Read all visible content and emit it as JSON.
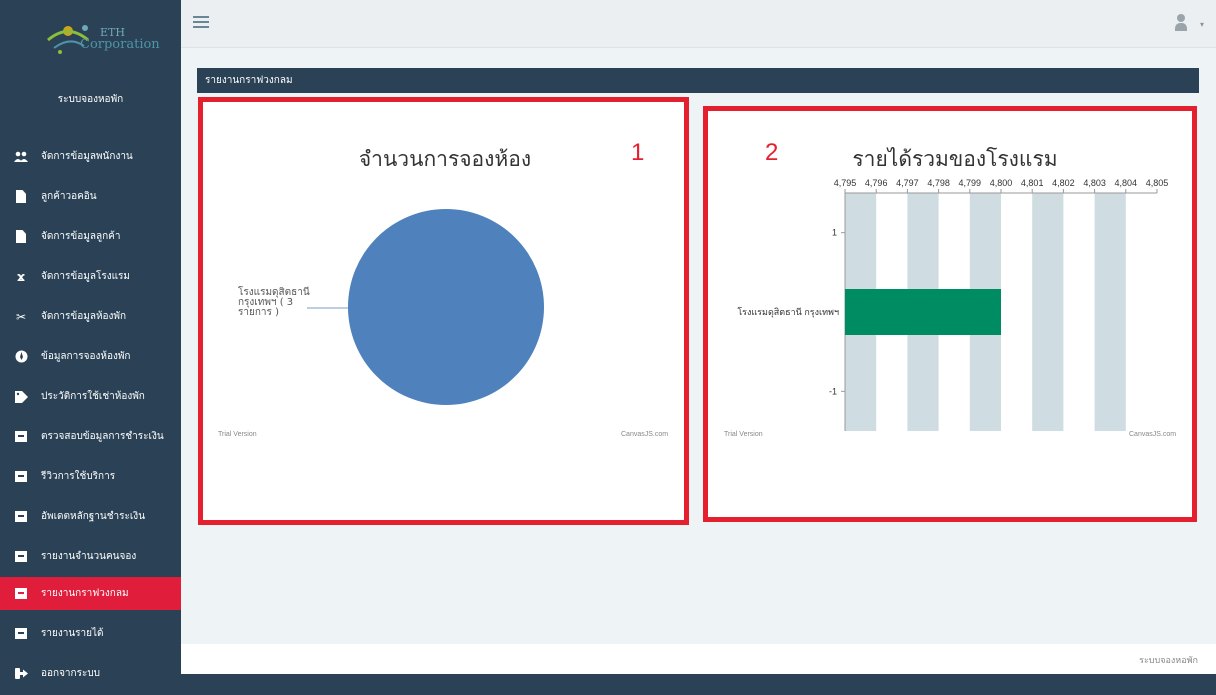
{
  "app": {
    "logo": {
      "small": "ETH",
      "big": "Corporation"
    },
    "title": "ระบบจองหอพัก"
  },
  "sidebar": {
    "items": [
      {
        "label": "จัดการข้อมูลพนักงาน",
        "icon": "users-icon"
      },
      {
        "label": "ลูกค้าวอคอิน",
        "icon": "file-icon"
      },
      {
        "label": "จัดการข้อมูลลูกค้า",
        "icon": "file-icon"
      },
      {
        "label": "จัดการข้อมูลโรงแรม",
        "icon": "xing-icon"
      },
      {
        "label": "จัดการข้อมูลห้องพัก",
        "icon": "scissors-icon"
      },
      {
        "label": "ข้อมูลการจองห้องพัก",
        "icon": "rebel-icon"
      },
      {
        "label": "ประวัติการใช้เช่าห้องพัก",
        "icon": "tag-icon"
      },
      {
        "label": "ตรวจสอบข้อมูลการชำระเงิน",
        "icon": "archive-icon"
      },
      {
        "label": "รีวิวการใช้บริการ",
        "icon": "archive-icon"
      },
      {
        "label": "อัพเดตหลักฐานชำระเงิน",
        "icon": "archive-icon"
      },
      {
        "label": "รายงานจำนวนคนจอง",
        "icon": "archive-icon"
      },
      {
        "label": "รายงานกราฟวงกลม",
        "icon": "archive-icon",
        "active": true
      },
      {
        "label": "รายงานรายได้",
        "icon": "archive-icon"
      },
      {
        "label": "ออกจากระบบ",
        "icon": "sign-out-icon"
      }
    ]
  },
  "page": {
    "heading": "รายงานกราฟวงกลม"
  },
  "charts": {
    "trial": "Trial Version",
    "brand": "CanvasJS.com"
  },
  "chart_data": [
    {
      "type": "pie",
      "title": "จำนวนการจองห้อง",
      "marker": "1",
      "slices": [
        {
          "label": "โรงแรมดุสิตธานี กรุงเทพฯ ( 3 รายการ )",
          "value": 3,
          "color": "#4f81bd"
        }
      ]
    },
    {
      "type": "bar",
      "orientation": "horizontal",
      "title": "รายได้รวมของโรงแรม",
      "marker": "2",
      "categories": [
        "โรงแรมดุสิตธานี กรุงเทพฯ"
      ],
      "values": [
        4800
      ],
      "color": "#008c63",
      "value_axis_ticks": [
        "4,795",
        "4,796",
        "4,797",
        "4,798",
        "4,799",
        "4,800",
        "4,801",
        "4,802",
        "4,803",
        "4,804",
        "4,805"
      ],
      "value_axis_range": [
        4795,
        4805
      ],
      "category_axis_ticks": [
        "1",
        "-1"
      ],
      "category_axis_range": [
        -1.5,
        1.5
      ]
    }
  ],
  "footer": {
    "text": "ระบบจองหอพัก"
  }
}
